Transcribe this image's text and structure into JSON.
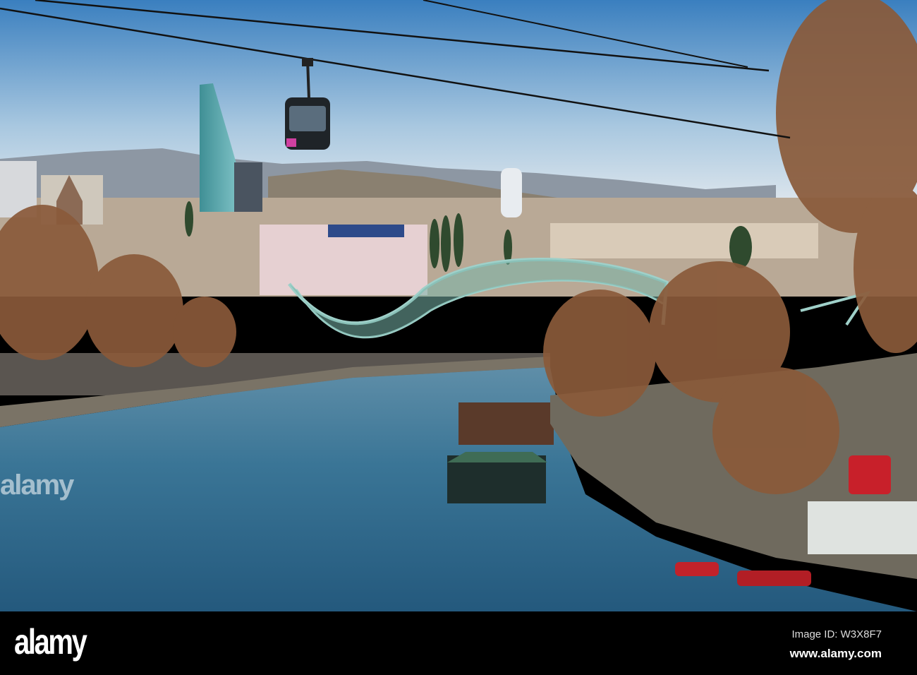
{
  "photo": {
    "subject": "Cable car over river with glass bridge",
    "colors": {
      "sky_top": "#3a7fbf",
      "sky_horizon": "#e3e9ee",
      "river": "#2f6b8f",
      "tree": "#8a5a3a",
      "bridge": "#7fb3ad"
    }
  },
  "watermark": {
    "logo": "alamy",
    "image_id": "Image ID: W3X8F7",
    "url": "www.alamy.com"
  }
}
